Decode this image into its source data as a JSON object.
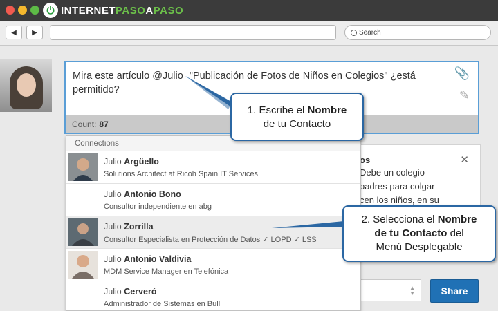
{
  "site": {
    "logo_text_white_1": "INTERNET",
    "logo_text_green": "PASO",
    "logo_text_white_2": "A",
    "logo_text_green_2": "PASO"
  },
  "browser": {
    "search_placeholder": "Search",
    "back_icon": "back-arrow-icon",
    "forward_icon": "forward-arrow-icon"
  },
  "composer": {
    "text_before_cursor": "Mira este artículo @Julio",
    "text_after_cursor": "  \"Publicación de Fotos de Niños en Colegios\" ¿está permitido?",
    "count_label": "Count:",
    "count_value": "87"
  },
  "dropdown": {
    "header": "Connections",
    "items": [
      {
        "first": "Julio",
        "last": "Argüello",
        "subtitle": "Solutions Architect at Ricoh Spain IT Services"
      },
      {
        "first": "Julio",
        "last": "Antonio Bono",
        "subtitle": "Consultor independiente en abg"
      },
      {
        "first": "Julio",
        "last": "Zorrilla",
        "subtitle": "Consultor Especialista en Protección de Datos ✓ LOPD ✓ LSS"
      },
      {
        "first": "Julio",
        "last": "Antonio Valdivia",
        "subtitle": "MDM Service Manager en Telefónica"
      },
      {
        "first": "Julio",
        "last": "Cerveró",
        "subtitle": "Administrador de Sistemas en Bull"
      }
    ]
  },
  "sidecard": {
    "title": "os",
    "body_1": "Debe un colegio",
    "body_2": "padres para colgar",
    "body_3": "cen los niños, en su"
  },
  "share_label": "Share",
  "callouts": {
    "one_prefix": "1. Escribe el ",
    "one_bold": "Nombre",
    "one_line2": "de tu Contacto",
    "two_prefix": "2. Selecciona el ",
    "two_bold": "Nombre",
    "two_bold2": "de tu Contacto",
    "two_suffix": " del",
    "two_line3": "Menú Desplegable"
  },
  "colors": {
    "titlebar": "#3b3b3b",
    "dot_red": "#f15a4f",
    "dot_yellow": "#f5b82e",
    "dot_green": "#5dbb46",
    "accent": "#2071b5",
    "callout_border": "#2b67a3"
  }
}
